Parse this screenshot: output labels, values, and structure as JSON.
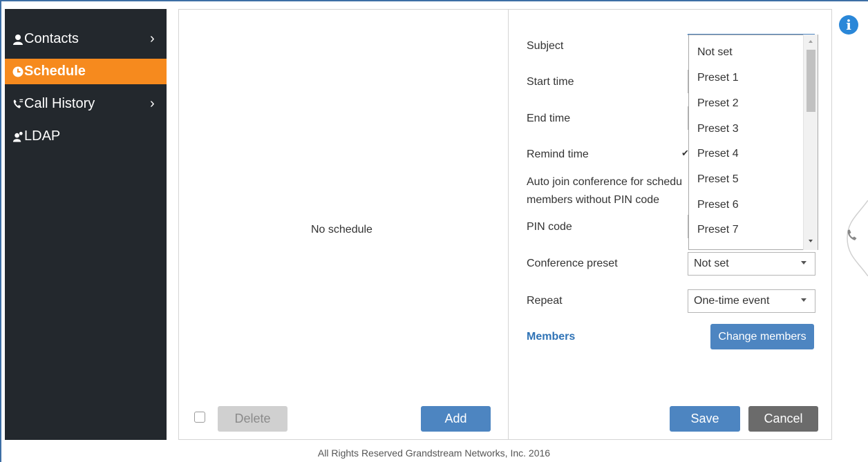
{
  "sidebar": {
    "items": [
      {
        "label": "Contacts",
        "icon": "person-icon",
        "has_chevron": true
      },
      {
        "label": "Schedule",
        "icon": "clock-icon",
        "active": true
      },
      {
        "label": "Call History",
        "icon": "phone-history-icon",
        "has_chevron": true
      },
      {
        "label": "LDAP",
        "icon": "ldap-user-icon"
      }
    ],
    "chevron": "›"
  },
  "list_pane": {
    "empty_text": "No schedule",
    "delete_label": "Delete",
    "add_label": "Add"
  },
  "form": {
    "subject_label": "Subject",
    "start_time_label": "Start time",
    "end_time_label": "End time",
    "remind_time_label": "Remind time",
    "auto_join_label_line1": "Auto join conference for schedu",
    "auto_join_label_line2": "members without PIN code",
    "pin_code_label": "PIN code",
    "conference_preset_label": "Conference preset",
    "conference_preset_value": "Not set",
    "repeat_label": "Repeat",
    "repeat_value": "One-time event",
    "members_label": "Members",
    "change_members_label": "Change members",
    "save_label": "Save",
    "cancel_label": "Cancel"
  },
  "preset_dropdown": {
    "options": [
      "Not set",
      "Preset 1",
      "Preset 2",
      "Preset 3",
      "Preset 4",
      "Preset 5",
      "Preset 6",
      "Preset 7"
    ]
  },
  "footer": {
    "text": "All Rights Reserved Grandstream Networks, Inc. 2016"
  },
  "colors": {
    "sidebar_bg": "#23282d",
    "active_nav": "#f68a1e",
    "primary_button": "#4d85c1",
    "cancel_button": "#6b6b6b",
    "link": "#2f73b6"
  }
}
